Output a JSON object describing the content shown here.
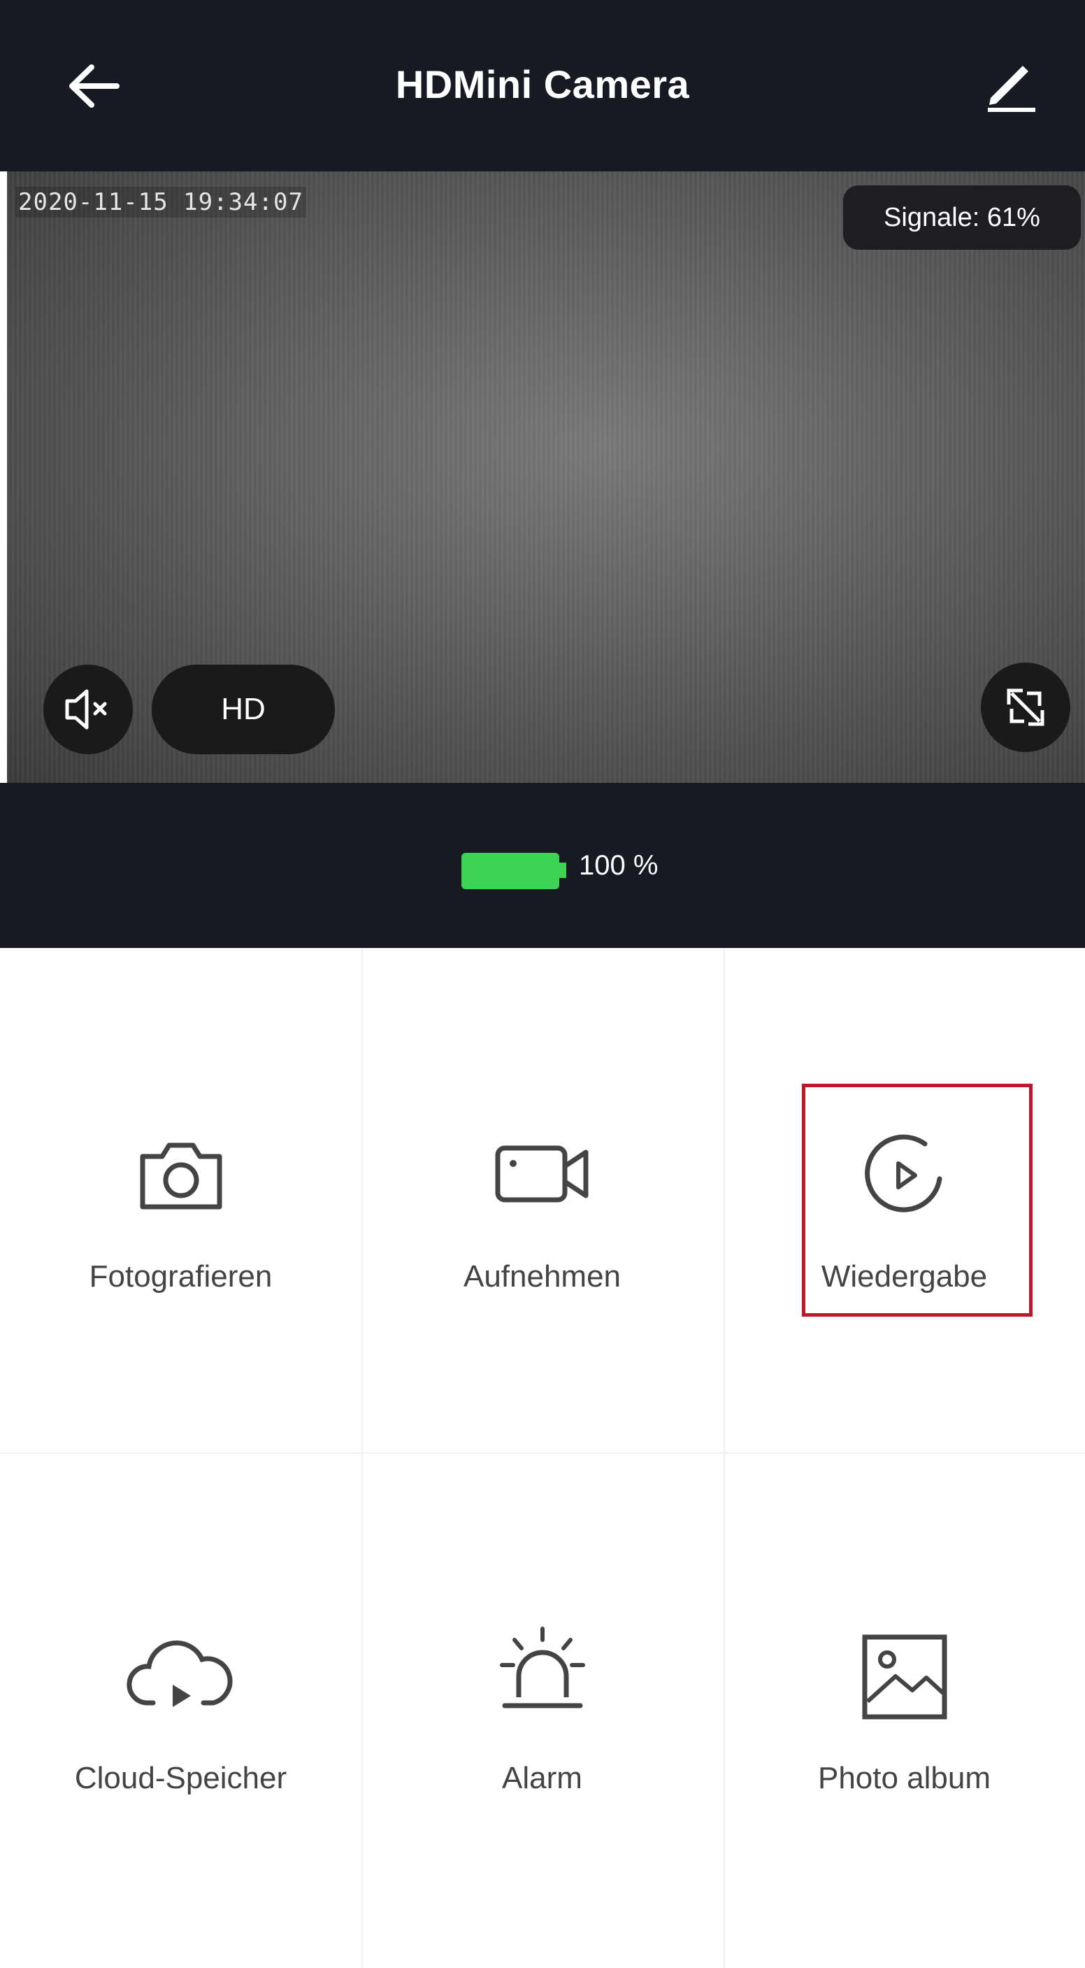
{
  "header": {
    "title": "HDMini Camera",
    "back_icon": "back-arrow-icon",
    "edit_icon": "edit-pencil-icon"
  },
  "video": {
    "timestamp": "2020-11-15 19:34:07",
    "signal": "Signale: 61%",
    "quality_label": "HD",
    "mute_icon": "speaker-muted-icon",
    "fullscreen_icon": "fullscreen-icon"
  },
  "battery": {
    "label": "100 %",
    "level": 1.0,
    "color": "#3dd455"
  },
  "actions": [
    {
      "label": "Fotografieren",
      "icon": "camera-icon"
    },
    {
      "label": "Aufnehmen",
      "icon": "video-camera-icon"
    },
    {
      "label": "Wiedergabe",
      "icon": "playback-icon"
    },
    {
      "label": "Cloud-Speicher",
      "icon": "cloud-play-icon"
    },
    {
      "label": "Alarm",
      "icon": "siren-icon"
    },
    {
      "label": "Photo album",
      "icon": "image-icon"
    }
  ],
  "colors": {
    "header_bg": "#171a23",
    "highlight": "#c0172b",
    "icon_gray": "#444444"
  }
}
